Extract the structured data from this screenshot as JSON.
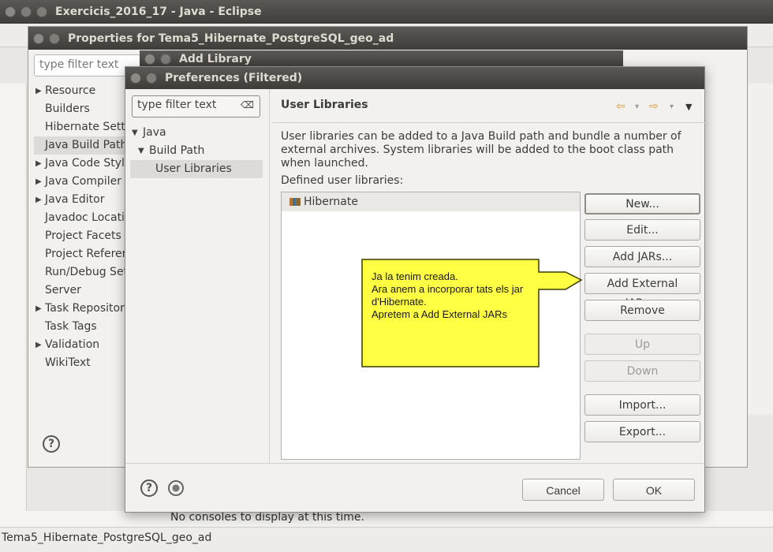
{
  "eclipse": {
    "title": "Exercicis_2016_17 - Java - Eclipse",
    "status_project": "Tema5_Hibernate_PostgreSQL_geo_ad",
    "console_text": "No consoles to display at this time."
  },
  "properties_dialog": {
    "title": "Properties for Tema5_Hibernate_PostgreSQL_geo_ad",
    "filter_placeholder": "type filter text",
    "tree": [
      {
        "label": "Resource",
        "expandable": true
      },
      {
        "label": "Builders",
        "expandable": false
      },
      {
        "label": "Hibernate Setti",
        "expandable": false
      },
      {
        "label": "Java Build Path",
        "expandable": false,
        "selected": true
      },
      {
        "label": "Java Code Style",
        "expandable": true
      },
      {
        "label": "Java Compiler",
        "expandable": true
      },
      {
        "label": "Java Editor",
        "expandable": true
      },
      {
        "label": "Javadoc Locati",
        "expandable": false
      },
      {
        "label": "Project Facets",
        "expandable": false
      },
      {
        "label": "Project Referer",
        "expandable": false
      },
      {
        "label": "Run/Debug Setti",
        "expandable": false
      },
      {
        "label": "Server",
        "expandable": false
      },
      {
        "label": "Task Repository",
        "expandable": true
      },
      {
        "label": "Task Tags",
        "expandable": false
      },
      {
        "label": "Validation",
        "expandable": true
      },
      {
        "label": "WikiText",
        "expandable": false
      }
    ]
  },
  "add_library_dialog": {
    "title": "Add Library"
  },
  "preferences_dialog": {
    "title": "Preferences (Filtered)",
    "filter_value": "type filter text",
    "tree": {
      "java": "Java",
      "build_path": "Build Path",
      "user_libraries": "User Libraries"
    },
    "page_title": "User Libraries",
    "description": "User libraries can be added to a Java Build path and bundle a number of external archives. System libraries will be added to the boot class path when launched.",
    "defined_label": "Defined user libraries:",
    "libraries": [
      "Hibernate"
    ],
    "buttons": {
      "new": "New...",
      "edit": "Edit...",
      "add_jars": "Add JARs...",
      "add_external_jars": "Add External JARs...",
      "remove": "Remove",
      "up": "Up",
      "down": "Down",
      "import": "Import...",
      "export": "Export..."
    },
    "cancel": "Cancel",
    "ok": "OK"
  },
  "callout": {
    "lines": [
      "Ja la tenim creada.",
      "Ara anem a incorporar tats els jar",
      "d'Hibernate.",
      "Apretem a Add External JARs"
    ],
    "fill_color": "#ffff44",
    "border_color": "#3a3a00"
  },
  "icons": {
    "close": "close-icon",
    "minimize": "minimize-icon",
    "help": "help-icon",
    "back": "back-arrow-icon",
    "forward": "forward-arrow-icon",
    "menu": "view-menu-icon",
    "library": "library-jar-icon"
  }
}
